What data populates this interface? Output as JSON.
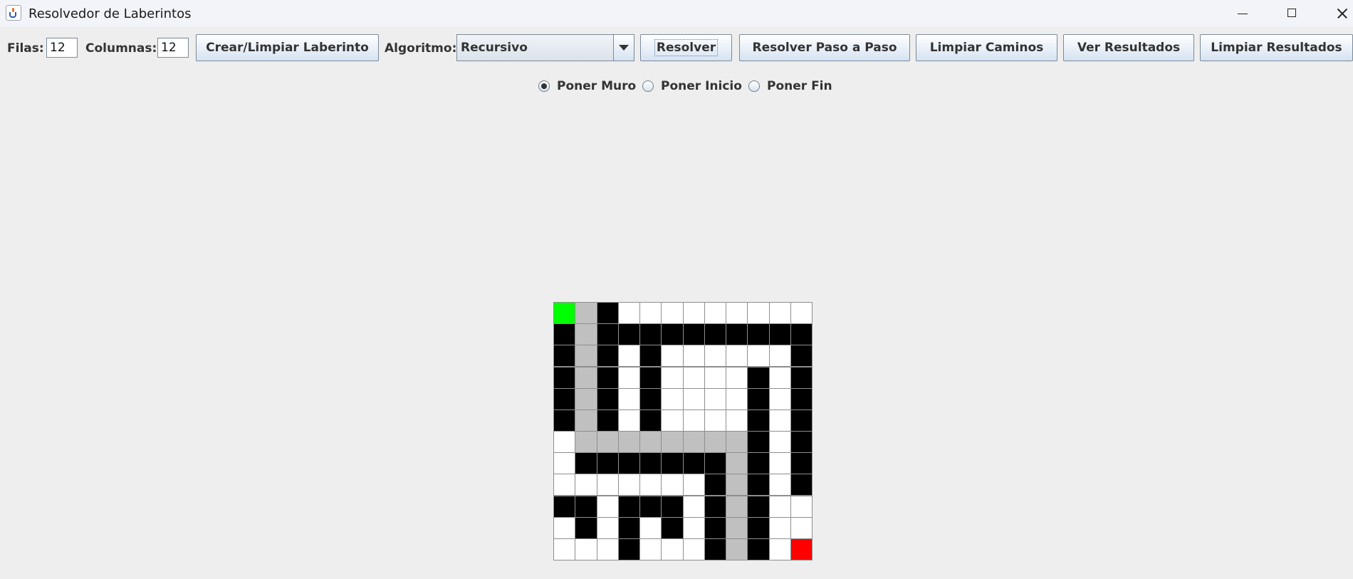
{
  "window": {
    "title": "Resolvedor de Laberintos"
  },
  "toolbar": {
    "rows_label": "Filas:",
    "rows_value": "12",
    "cols_label": "Columnas:",
    "cols_value": "12",
    "create_label": "Crear/Limpiar Laberinto",
    "algorithm_label": "Algoritmo:",
    "algorithm_selected": "Recursivo",
    "solve_label": "Resolver",
    "step_label": "Resolver Paso a Paso",
    "clear_paths_label": "Limpiar Caminos",
    "view_results_label": "Ver Resultados",
    "clear_results_label": "Limpiar Resultados"
  },
  "modes": {
    "wall": "Poner Muro",
    "start": "Poner Inicio",
    "end": "Poner Fin",
    "selected": "wall"
  },
  "maze": {
    "rows": 12,
    "cols": 12,
    "legend": {
      "S": "start",
      "F": "end",
      "W": "wall",
      "E": "empty",
      "P": "path"
    },
    "colors": {
      "start": "#00ff00",
      "end": "#ff0000",
      "wall": "#000000",
      "empty": "#ffffff",
      "path": "#c0c0c0"
    },
    "grid": [
      [
        "S",
        "P",
        "W",
        "E",
        "E",
        "E",
        "E",
        "E",
        "E",
        "E",
        "E",
        "E"
      ],
      [
        "W",
        "P",
        "W",
        "W",
        "W",
        "W",
        "W",
        "W",
        "W",
        "W",
        "W",
        "W"
      ],
      [
        "W",
        "P",
        "W",
        "E",
        "W",
        "E",
        "E",
        "E",
        "E",
        "E",
        "E",
        "W"
      ],
      [
        "W",
        "P",
        "W",
        "E",
        "W",
        "E",
        "E",
        "E",
        "E",
        "W",
        "E",
        "W"
      ],
      [
        "W",
        "P",
        "W",
        "E",
        "W",
        "E",
        "E",
        "E",
        "E",
        "W",
        "E",
        "W"
      ],
      [
        "W",
        "P",
        "W",
        "E",
        "W",
        "E",
        "E",
        "E",
        "E",
        "W",
        "E",
        "W"
      ],
      [
        "E",
        "P",
        "P",
        "P",
        "P",
        "P",
        "P",
        "P",
        "P",
        "W",
        "E",
        "W"
      ],
      [
        "E",
        "W",
        "W",
        "W",
        "W",
        "W",
        "W",
        "W",
        "P",
        "W",
        "E",
        "W"
      ],
      [
        "E",
        "E",
        "E",
        "E",
        "E",
        "E",
        "E",
        "W",
        "P",
        "W",
        "E",
        "W"
      ],
      [
        "W",
        "W",
        "E",
        "W",
        "W",
        "W",
        "E",
        "W",
        "P",
        "W",
        "E",
        "E"
      ],
      [
        "E",
        "W",
        "E",
        "W",
        "E",
        "W",
        "E",
        "W",
        "P",
        "W",
        "E",
        "E"
      ],
      [
        "E",
        "E",
        "E",
        "W",
        "E",
        "E",
        "E",
        "W",
        "P",
        "W",
        "E",
        "F"
      ]
    ]
  }
}
